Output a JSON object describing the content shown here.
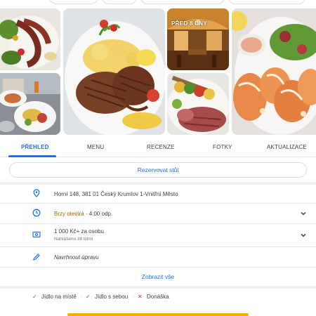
{
  "gallery": {
    "badge": "PŘED 8 DNY",
    "photos": [
      "photo-octopus-salad",
      "photo-steak-potatoes",
      "photo-restaurant-interior",
      "photo-shrimp-plate",
      "photo-table-dishes",
      "photo-skewer-meat"
    ]
  },
  "tabs": [
    {
      "label": "PŘEHLED",
      "active": true
    },
    {
      "label": "MENU",
      "active": false
    },
    {
      "label": "RECENZE",
      "active": false
    },
    {
      "label": "FOTKY",
      "active": false
    },
    {
      "label": "AKTUALIZACE",
      "active": false
    }
  ],
  "reserve_label": "Rezervovat stůl",
  "info": {
    "address": "Horní 148, 381 01 Český Krumlov 1-Vnitřní Město",
    "hours_status": "Brzy otevírá",
    "hours_sep": " · ",
    "hours_time": "4:00 odp.",
    "price": "1 000 Kč+ za osobu",
    "price_sub": "Nahlášeno 38 lidmi",
    "suggest_edit": "Navrhnout úpravu"
  },
  "show_all": "Zobrazit vše",
  "services": [
    {
      "label": "Jídlo na místě",
      "available": true
    },
    {
      "label": "Jídlo s sebou",
      "available": true
    },
    {
      "label": "Donáška",
      "available": false
    }
  ],
  "service_marks": {
    "yes": "✓",
    "no": "✕"
  },
  "colors": {
    "accent": "#1a73e8",
    "open_soon": "#b06000",
    "check": "#188038",
    "cross": "#d93025",
    "bottom_bar": "#f9ab00"
  }
}
